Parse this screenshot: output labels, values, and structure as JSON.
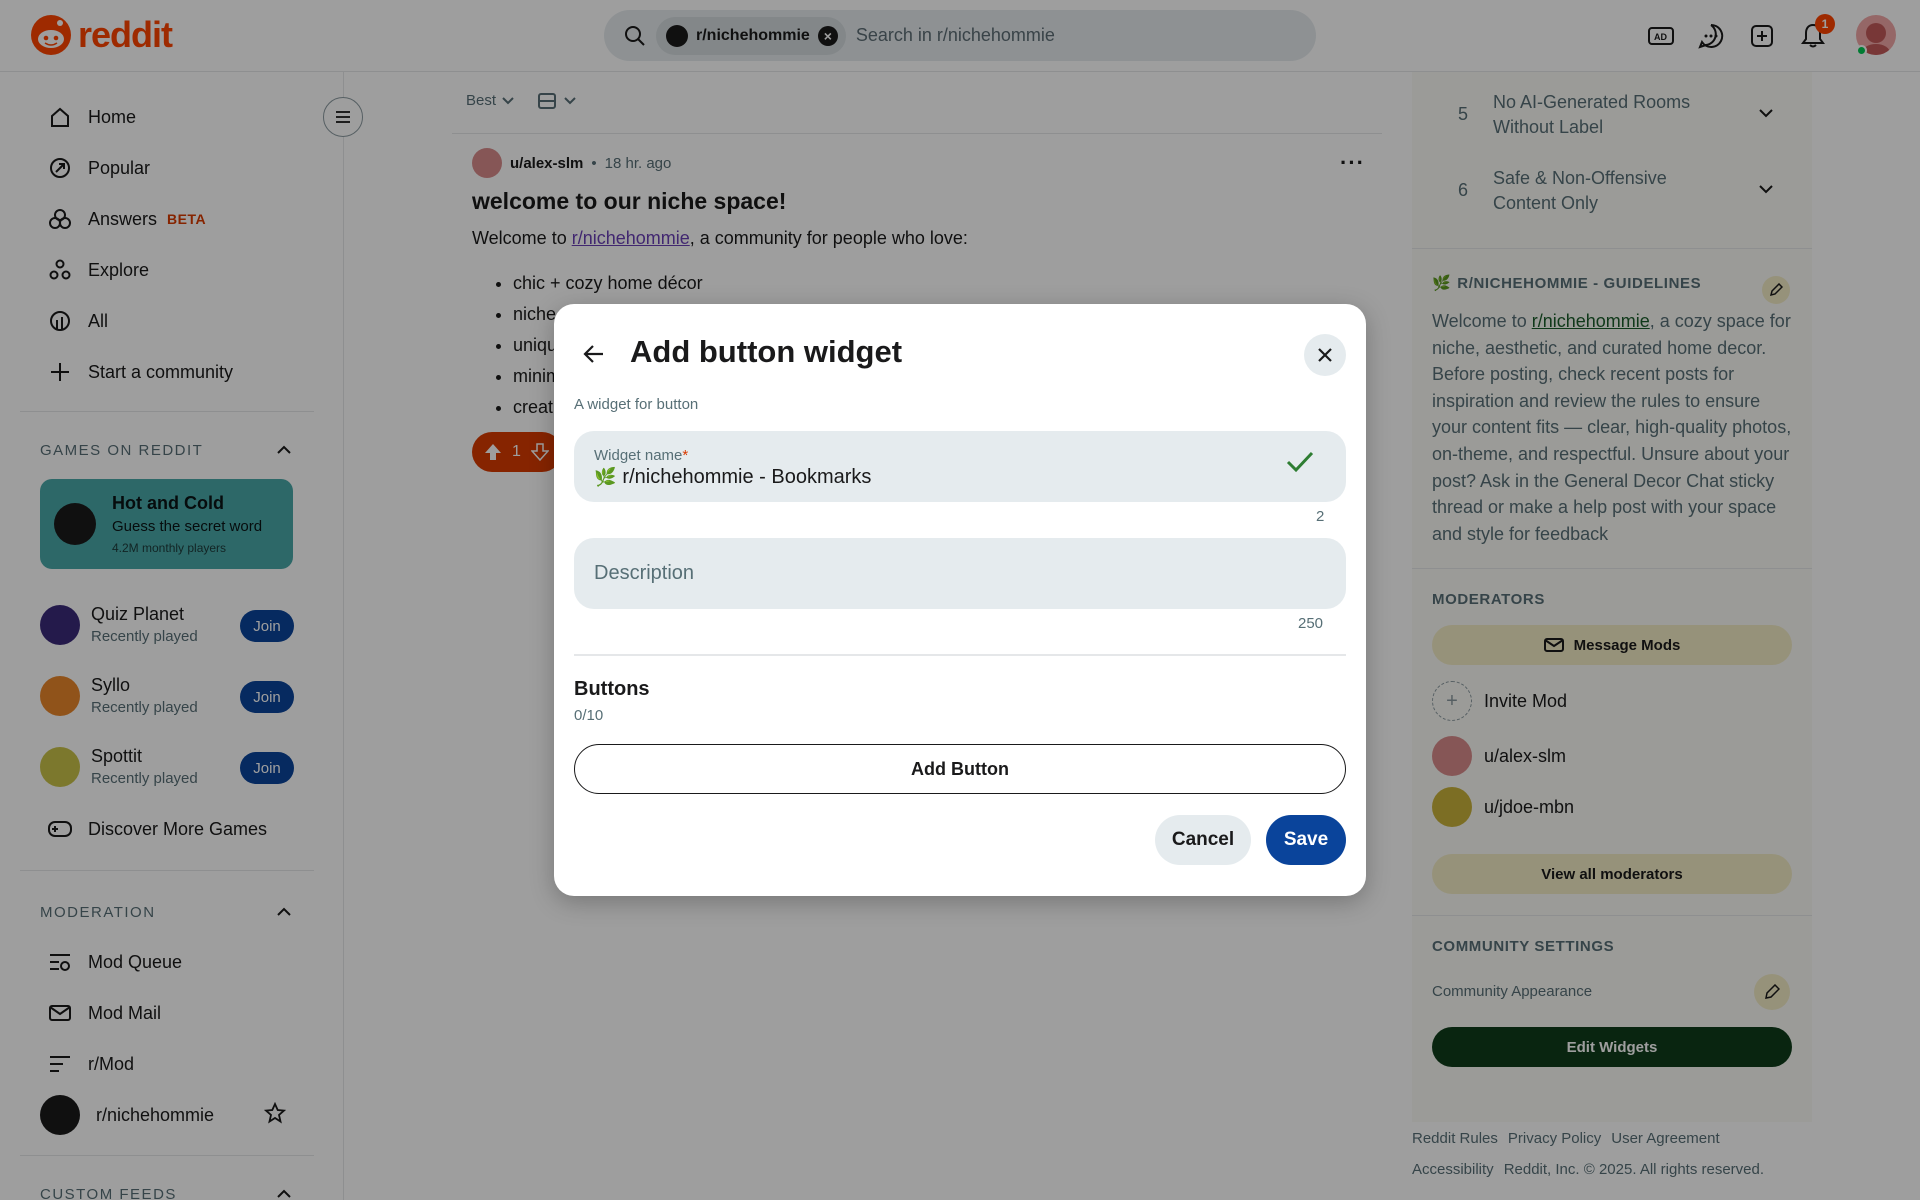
{
  "header": {
    "logo_text": "reddit",
    "search_chip": "r/nichehommie",
    "search_placeholder": "Search in r/nichehommie",
    "notification_count": "1"
  },
  "sidebar": {
    "nav": [
      {
        "label": "Home",
        "icon": "home-icon"
      },
      {
        "label": "Popular",
        "icon": "popular-icon"
      },
      {
        "label": "Answers",
        "icon": "answers-icon",
        "badge": "BETA"
      },
      {
        "label": "Explore",
        "icon": "explore-icon"
      },
      {
        "label": "All",
        "icon": "all-icon"
      },
      {
        "label": "Start a community",
        "icon": "plus-icon"
      }
    ],
    "games_heading": "GAMES ON REDDIT",
    "featured_game": {
      "title": "Hot and Cold",
      "subtitle": "Guess the secret word",
      "players": "4.2M monthly players"
    },
    "games": [
      {
        "name": "Quiz Planet",
        "status": "Recently played",
        "join": "Join"
      },
      {
        "name": "Syllo",
        "status": "Recently played",
        "join": "Join"
      },
      {
        "name": "Spottit",
        "status": "Recently played",
        "join": "Join"
      }
    ],
    "discover": "Discover More Games",
    "moderation_heading": "MODERATION",
    "mod_items": [
      "Mod Queue",
      "Mod Mail",
      "r/Mod",
      "r/nichehommie"
    ],
    "custom_feeds_heading": "CUSTOM FEEDS"
  },
  "feed": {
    "sort": "Best",
    "post": {
      "author": "u/alex-slm",
      "time": "18 hr. ago",
      "title": "welcome to our niche space!",
      "body_prefix": "Welcome to ",
      "body_link": "r/nichehommie",
      "body_suffix": ", a community for people who love:",
      "bullets": [
        "chic + cozy home décor",
        "niche",
        "uniqu",
        "minim",
        "creat"
      ],
      "votes": "1"
    }
  },
  "right": {
    "rules": [
      {
        "num": "5",
        "text": "No AI-Generated Rooms Without Label"
      },
      {
        "num": "6",
        "text": "Safe & Non-Offensive Content Only"
      }
    ],
    "guidelines_heading": "R/NICHEHOMMIE - GUIDELINES",
    "guidelines_prefix": "Welcome to ",
    "guidelines_link": "r/nichehommie",
    "guidelines_suffix": ", a cozy space for niche, aesthetic, and curated home decor. Before posting, check recent posts for inspiration and review the rules to ensure your content fits — clear, high-quality photos, on-theme, and respectful. Unsure about your post? Ask in the General Decor Chat sticky thread or make a help post with your space and style for feedback",
    "moderators_heading": "MODERATORS",
    "message_mods": "Message Mods",
    "invite_mod": "Invite Mod",
    "mods": [
      "u/alex-slm",
      "u/jdoe-mbn"
    ],
    "view_all": "View all moderators",
    "community_settings_heading": "COMMUNITY SETTINGS",
    "community_appearance": "Community Appearance",
    "edit_widgets": "Edit Widgets",
    "footer_row1": [
      "Reddit Rules",
      "Privacy Policy",
      "User Agreement"
    ],
    "footer_row2": [
      "Accessibility",
      "Reddit, Inc. © 2025. All rights reserved."
    ]
  },
  "modal": {
    "title": "Add button widget",
    "subtitle": "A widget for button",
    "widget_name_label": "Widget name",
    "widget_name_required": "*",
    "widget_name_value": "r/nichehommie - Bookmarks",
    "widget_name_counter": "2",
    "description_placeholder": "Description",
    "description_counter": "250",
    "buttons_heading": "Buttons",
    "buttons_count": "0/10",
    "add_button": "Add Button",
    "cancel": "Cancel",
    "save": "Save"
  },
  "colors": {
    "brand": "#ff4500",
    "primary": "#0a449b",
    "edit_widgets_bg": "#0f3d1a",
    "overlay": "rgba(0,0,0,0.38)"
  }
}
